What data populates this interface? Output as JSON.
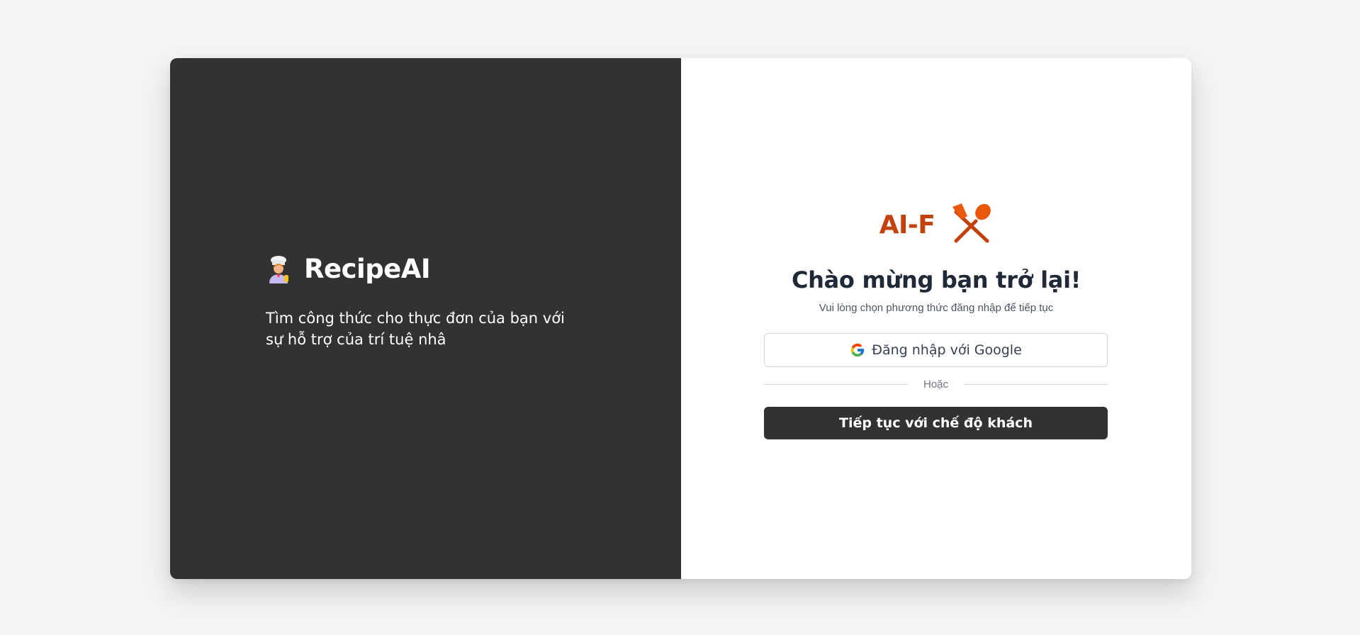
{
  "left_panel": {
    "brand_icon": "chef-icon",
    "brand_name": "RecipeAI",
    "tagline": "Tìm công thức cho thực đơn của bạn với sự hỗ trợ của trí tuệ nhâ"
  },
  "right_panel": {
    "logo_text": "AI-F",
    "logo_icon": "fork-spoon-icon",
    "welcome_title": "Chào mừng bạn trở lại!",
    "subtitle": "Vui lòng chọn phương thức đăng nhập để tiếp tục",
    "google_button": {
      "icon": "google-icon",
      "label": "Đăng nhập với Google"
    },
    "divider_text": "Hoặc",
    "guest_button": {
      "label": "Tiếp tục với chế độ khách"
    }
  },
  "colors": {
    "page_background": "#f3f4f6",
    "left_panel_background": "#323232",
    "accent": "#c2410c",
    "guest_button_background": "#323232"
  }
}
